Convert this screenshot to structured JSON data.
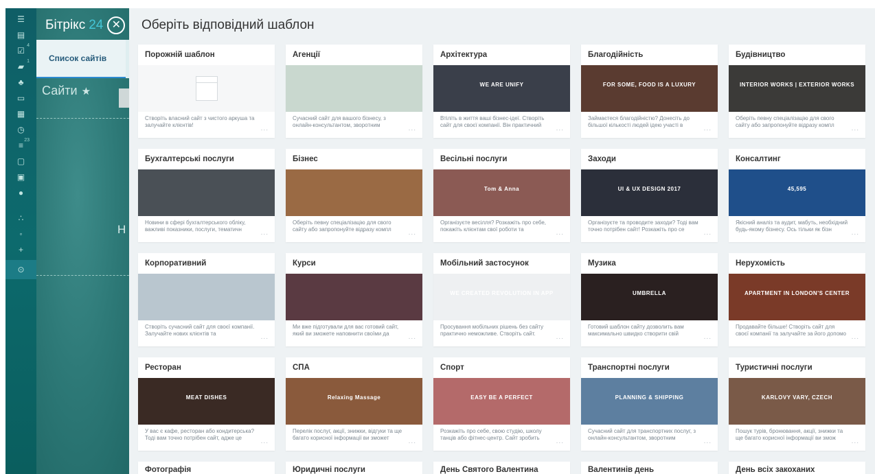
{
  "app": {
    "brand_name": "Бітрікс",
    "brand_number": "24",
    "close_glyph": "✕"
  },
  "rail": {
    "badges": [
      "4",
      "1",
      "23"
    ]
  },
  "background": {
    "tab_label": "Список сайтів",
    "page_title": "Сайти",
    "star_glyph": "★",
    "letter": "Н"
  },
  "slider": {
    "title": "Оберіть відповідний шаблон",
    "more_glyph": "..."
  },
  "templates": [
    {
      "title": "Порожній шаблон",
      "desc": "Створіть власний сайт з чистого аркуша та залучайте клієнтів!",
      "bg": "#f6f7f8",
      "overlay": ""
    },
    {
      "title": "Агенції",
      "desc": "Сучасний сайт для вашого бізнесу, з онлайн-консультантом, зворотним",
      "bg": "#c9d8cf",
      "overlay": ""
    },
    {
      "title": "Архітектура",
      "desc": "Втіліть в життя ваші бізнес-ідеї. Створіть сайт для своєї компанії. Він практичний",
      "bg": "#3a3f4a",
      "overlay": "WE ARE UNIFY"
    },
    {
      "title": "Благодійність",
      "desc": "Займаєтеся благодійністю? Донесіть до більшої кількості людей ідею участі в",
      "bg": "#5a3b30",
      "overlay": "FOR SOME, FOOD IS A LUXURY"
    },
    {
      "title": "Будівництво",
      "desc": "Оберіть певну спеціалізацію для свого сайту або запропонуйте відразу компл",
      "bg": "#3b3a38",
      "overlay": "INTERIOR WORKS | EXTERIOR WORKS"
    },
    {
      "title": "Бухгалтерські послуги",
      "desc": "Новини в сфері бухгалтерського обліку, важливі показники, послуги, тематичн",
      "bg": "#4a5056",
      "overlay": ""
    },
    {
      "title": "Бізнес",
      "desc": "Оберіть певну спеціалізацію для свого сайту або запропонуйте відразу компл",
      "bg": "#9a6a44",
      "overlay": ""
    },
    {
      "title": "Весільні послуги",
      "desc": "Організуєте весілля? Розкажіть про себе, покажіть клієнтам свої роботи та",
      "bg": "#8b5a54",
      "overlay": "Tom & Anna"
    },
    {
      "title": "Заходи",
      "desc": "Організуєте та проводите заходи? Тоді вам точно потрібен сайт! Розкажіть про се",
      "bg": "#2b2f3a",
      "overlay": "UI & UX DESIGN 2017"
    },
    {
      "title": "Консалтинг",
      "desc": "Якісний аналіз та аудит, мабуть, необхідний будь-якому бізнесу. Ось тільки як бізн",
      "bg": "#1f4f8a",
      "overlay": "45,595"
    },
    {
      "title": "Корпоративний",
      "desc": "Створіть сучасний сайт для своєї компанії. Залучайте нових клієнтів та",
      "bg": "#b9c6cf",
      "overlay": ""
    },
    {
      "title": "Курси",
      "desc": "Ми вже підготували для вас готовий сайт, який ви зможете наповнити своїми да",
      "bg": "#5a3a42",
      "overlay": ""
    },
    {
      "title": "Мобільний застосунок",
      "desc": "Просування мобільних рішень без сайту практично неможливе. Створіть сайт.",
      "bg": "#eef0f2",
      "overlay": "WE CREATED REVOLUTION IN APP"
    },
    {
      "title": "Музика",
      "desc": "Готовий шаблон сайту дозволить вам максимально швидко створити свій",
      "bg": "#2a2020",
      "overlay": "UMBRELLA"
    },
    {
      "title": "Нерухомість",
      "desc": "Продавайте більше! Створіть сайт для своєї компанії та залучайте за його допомо",
      "bg": "#7a3a28",
      "overlay": "APARTMENT IN LONDON'S CENTER"
    },
    {
      "title": "Ресторан",
      "desc": "У вас є кафе, ресторан або кондитерська? Тоді вам точно потрібен сайт, адже це",
      "bg": "#3a2a24",
      "overlay": "MEAT DISHES"
    },
    {
      "title": "СПА",
      "desc": "Перелік послуг, акції, знижки, відгуки та ще багато корисної інформації ви зможет",
      "bg": "#8a5a3c",
      "overlay": "Relaxing Massage"
    },
    {
      "title": "Спорт",
      "desc": "Розкажіть про себе, свою студію, школу танців або фітнес-центр. Сайт зробить",
      "bg": "#b46a6a",
      "overlay": "EASY BE A PERFECT"
    },
    {
      "title": "Транспортні послуги",
      "desc": "Сучасний сайт для транспортних послуг, з онлайн-консультантом, зворотним",
      "bg": "#5d7fa0",
      "overlay": "PLANNING & SHIPPING"
    },
    {
      "title": "Туристичні послуги",
      "desc": "Пошук турів, бронювання, акції, знижки та ще багато корисної інформації ви змож",
      "bg": "#7a5a48",
      "overlay": "KARLOVY VARY, CZECH"
    },
    {
      "title": "Фотографія",
      "desc": "",
      "bg": "#ffffff",
      "overlay": ""
    },
    {
      "title": "Юридичні послуги",
      "desc": "",
      "bg": "#ffffff",
      "overlay": ""
    },
    {
      "title": "День Святого Валентина",
      "desc": "",
      "bg": "#ffffff",
      "overlay": ""
    },
    {
      "title": "Валентинів день",
      "desc": "",
      "bg": "#ffffff",
      "overlay": ""
    },
    {
      "title": "День всіх закоханих",
      "desc": "",
      "bg": "#ffffff",
      "overlay": ""
    }
  ]
}
